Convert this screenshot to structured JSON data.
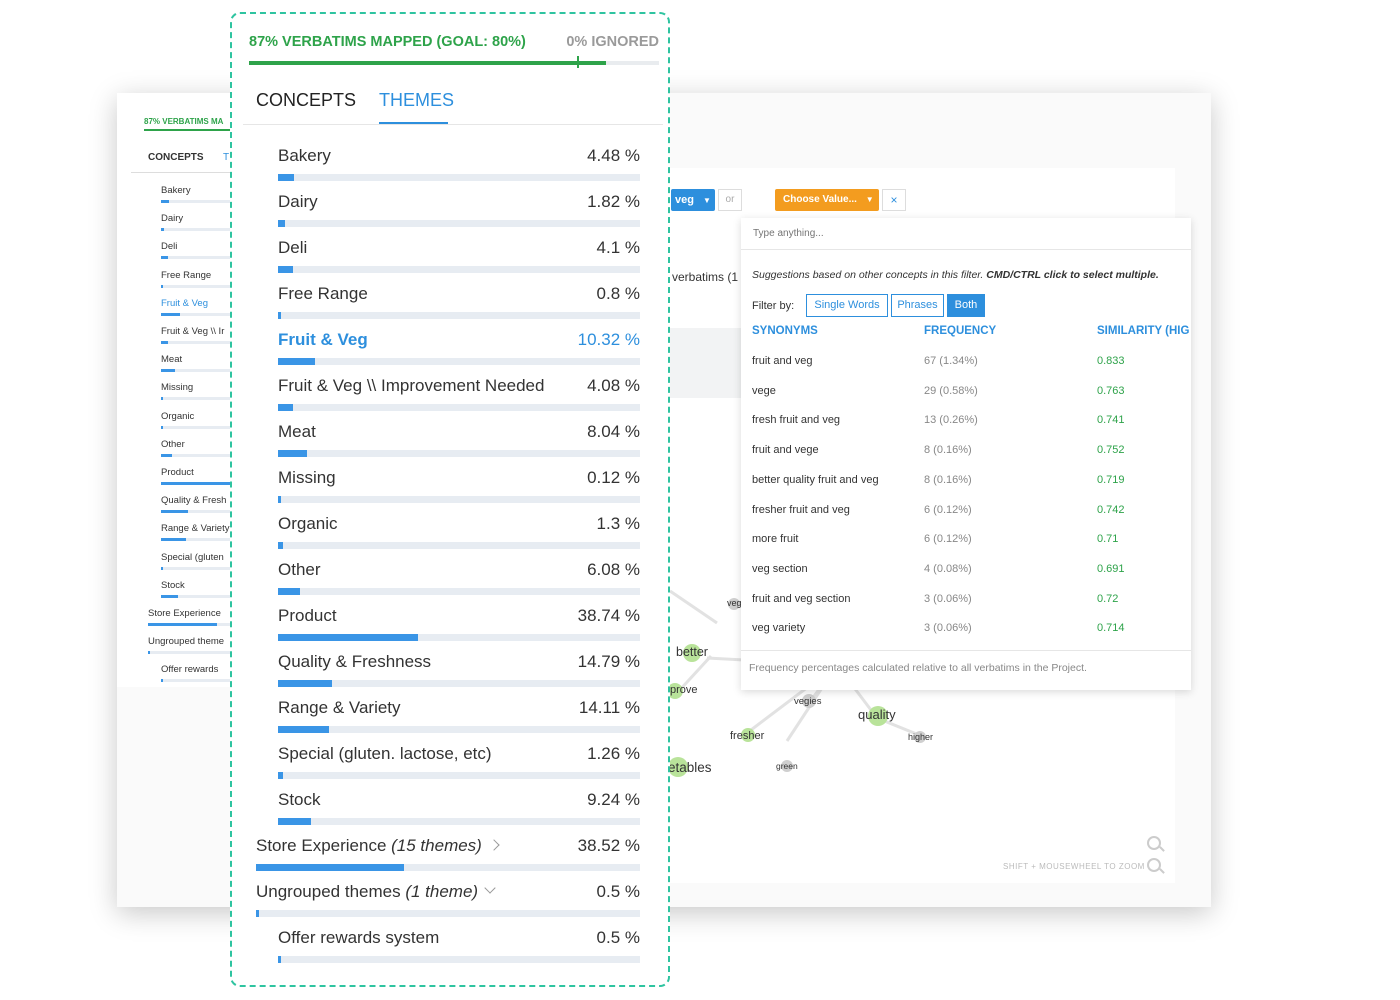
{
  "panel": {
    "mapped_text": "87% VERBATIMS MAPPED (GOAL: 80%)",
    "ignored_text": "0% IGNORED",
    "mapped_fraction": 0.87,
    "goal_fraction": 0.8,
    "tabs": [
      {
        "label": "CONCEPTS",
        "active": false
      },
      {
        "label": "THEMES",
        "active": true
      }
    ],
    "themes": [
      {
        "label": "Bakery",
        "pct": "4.48 %",
        "value": 4.48,
        "active": false,
        "indent": true
      },
      {
        "label": "Dairy",
        "pct": "1.82 %",
        "value": 1.82,
        "active": false,
        "indent": true
      },
      {
        "label": "Deli",
        "pct": "4.1 %",
        "value": 4.1,
        "active": false,
        "indent": true
      },
      {
        "label": "Free Range",
        "pct": "0.8 %",
        "value": 0.8,
        "active": false,
        "indent": true
      },
      {
        "label": "Fruit & Veg",
        "pct": "10.32 %",
        "value": 10.32,
        "active": true,
        "indent": true
      },
      {
        "label": "Fruit & Veg \\\\ Improvement Needed",
        "pct": "4.08 %",
        "value": 4.08,
        "active": false,
        "indent": true
      },
      {
        "label": "Meat",
        "pct": "8.04 %",
        "value": 8.04,
        "active": false,
        "indent": true
      },
      {
        "label": "Missing",
        "pct": "0.12 %",
        "value": 0.12,
        "active": false,
        "indent": true
      },
      {
        "label": "Organic",
        "pct": "1.3 %",
        "value": 1.3,
        "active": false,
        "indent": true
      },
      {
        "label": "Other",
        "pct": "6.08 %",
        "value": 6.08,
        "active": false,
        "indent": true
      },
      {
        "label": "Product",
        "pct": "38.74 %",
        "value": 38.74,
        "active": false,
        "indent": true
      },
      {
        "label": "Quality & Freshness",
        "pct": "14.79 %",
        "value": 14.79,
        "active": false,
        "indent": true
      },
      {
        "label": "Range & Variety",
        "pct": "14.11 %",
        "value": 14.11,
        "active": false,
        "indent": true
      },
      {
        "label": "Special (gluten. lactose, etc)",
        "pct": "1.26 %",
        "value": 1.26,
        "active": false,
        "indent": true
      },
      {
        "label": "Stock",
        "pct": "9.24 %",
        "value": 9.24,
        "active": false,
        "indent": true
      },
      {
        "label": "Store Experience",
        "sub": "(15 themes)",
        "chevron": "right",
        "pct": "38.52 %",
        "value": 38.52,
        "active": false,
        "indent": false
      },
      {
        "label": "Ungrouped themes",
        "sub": "(1 theme)",
        "chevron": "down",
        "pct": "0.5 %",
        "value": 0.5,
        "active": false,
        "indent": false
      },
      {
        "label": "Offer rewards system",
        "pct": "0.5 %",
        "value": 0.5,
        "active": false,
        "indent": true
      }
    ]
  },
  "bg_sidebar": {
    "mapped_text": "87% VERBATIMS MA",
    "concepts_tab": "CONCEPTS",
    "themes_tab": "T",
    "items": [
      {
        "label": "Bakery",
        "value": 4.48,
        "active": false,
        "indent": true
      },
      {
        "label": "Dairy",
        "value": 1.82,
        "active": false,
        "indent": true
      },
      {
        "label": "Deli",
        "value": 4.1,
        "active": false,
        "indent": true
      },
      {
        "label": "Free Range",
        "value": 0.8,
        "active": false,
        "indent": true
      },
      {
        "label": "Fruit & Veg",
        "value": 10.32,
        "active": true,
        "indent": true
      },
      {
        "label": "Fruit & Veg \\\\ Ir",
        "value": 4.08,
        "active": false,
        "indent": true
      },
      {
        "label": "Meat",
        "value": 8.04,
        "active": false,
        "indent": true
      },
      {
        "label": "Missing",
        "value": 0.12,
        "active": false,
        "indent": true
      },
      {
        "label": "Organic",
        "value": 1.3,
        "active": false,
        "indent": true
      },
      {
        "label": "Other",
        "value": 6.08,
        "active": false,
        "indent": true
      },
      {
        "label": "Product",
        "value": 38.74,
        "active": false,
        "indent": true
      },
      {
        "label": "Quality & Fresh",
        "value": 14.79,
        "active": false,
        "indent": true
      },
      {
        "label": "Range & Variety",
        "value": 14.11,
        "active": false,
        "indent": true
      },
      {
        "label": "Special (gluten",
        "value": 1.26,
        "active": false,
        "indent": true
      },
      {
        "label": "Stock",
        "value": 9.24,
        "active": false,
        "indent": true
      },
      {
        "label": "Store Experience",
        "value": 38.52,
        "active": false,
        "indent": false
      },
      {
        "label": "Ungrouped theme",
        "value": 0.5,
        "active": false,
        "indent": false
      },
      {
        "label": "Offer rewards",
        "value": 0.5,
        "active": false,
        "indent": true
      }
    ]
  },
  "filter": {
    "veg_chip": "veg",
    "or_label": "or",
    "choose_value": "Choose Value...",
    "close_glyph": "×",
    "verbatims_text": "verbatims (1"
  },
  "dropdown": {
    "placeholder": "Type anything...",
    "suggestion_note": "Suggestions based on other concepts in this filter.",
    "suggestion_bold": "CMD/CTRL click to select multiple.",
    "filter_by": "Filter by:",
    "filter_options": [
      {
        "label": "Single Words",
        "active": false
      },
      {
        "label": "Phrases",
        "active": false
      },
      {
        "label": "Both",
        "active": true
      }
    ],
    "headers": {
      "synonyms": "SYNONYMS",
      "frequency": "FREQUENCY",
      "similarity": "SIMILARITY (HIG"
    },
    "rows": [
      {
        "synonym": "fruit and veg",
        "freq": "67  (1.34%)",
        "similarity": "0.833"
      },
      {
        "synonym": "vege",
        "freq": "29  (0.58%)",
        "similarity": "0.763"
      },
      {
        "synonym": "fresh fruit and veg",
        "freq": "13  (0.26%)",
        "similarity": "0.741"
      },
      {
        "synonym": "fruit and vege",
        "freq": "8  (0.16%)",
        "similarity": "0.752"
      },
      {
        "synonym": "better quality fruit and veg",
        "freq": "8  (0.16%)",
        "similarity": "0.719"
      },
      {
        "synonym": "fresher fruit and veg",
        "freq": "6  (0.12%)",
        "similarity": "0.742"
      },
      {
        "synonym": "more fruit",
        "freq": "6  (0.12%)",
        "similarity": "0.71"
      },
      {
        "synonym": "veg section",
        "freq": "4  (0.08%)",
        "similarity": "0.691"
      },
      {
        "synonym": "fruit and veg section",
        "freq": "3  (0.06%)",
        "similarity": "0.72"
      },
      {
        "synonym": "veg variety",
        "freq": "3  (0.06%)",
        "similarity": "0.714"
      }
    ],
    "footer": "Frequency percentages calculated relative to all verbatims in the Project."
  },
  "graph": {
    "labels": {
      "veg": "veg",
      "better": "better",
      "prove": "prove",
      "vegies": "vegies",
      "quality": "quality",
      "fresher": "fresher",
      "higher": "higher",
      "etables": "etables",
      "green": "green"
    },
    "hint": "SHIFT + MOUSEWHEEL TO ZOOM"
  },
  "colors": {
    "accent": "#2d8fdd",
    "bar": "#3a95e6",
    "track": "#e7ecf2",
    "mapped_green": "#2ea34a",
    "panel_border": "#2ec4a0",
    "orange": "#f39c1f",
    "node_green": "#b9e39a"
  }
}
